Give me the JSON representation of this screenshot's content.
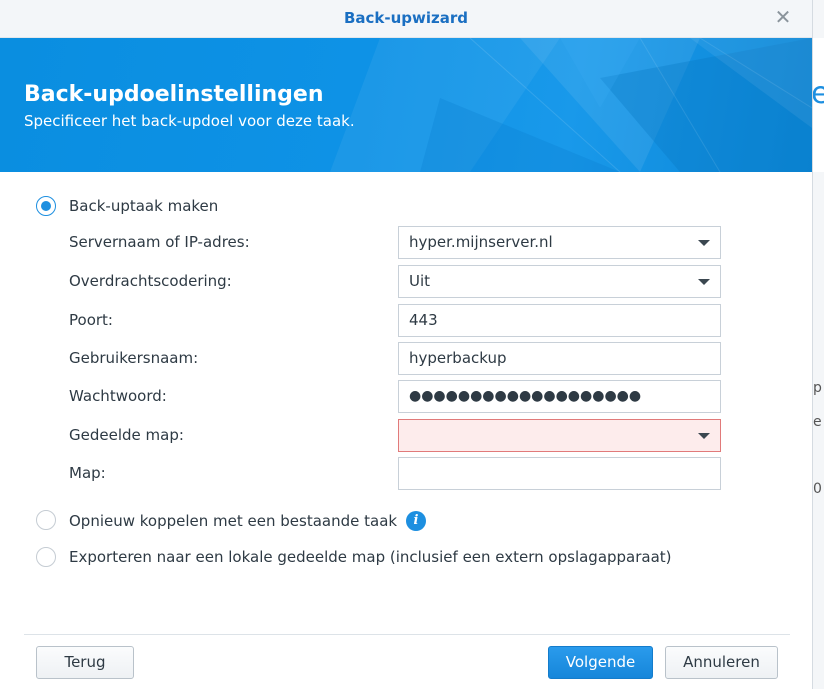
{
  "window": {
    "title": "Back-upwizard"
  },
  "banner": {
    "heading": "Back-updoelinstellingen",
    "subheading": "Specificeer het back-updoel voor deze taak."
  },
  "options": {
    "create": "Back-uptaak maken",
    "relink": "Opnieuw koppelen met een bestaande taak",
    "export": "Exporteren naar een lokale gedeelde map (inclusief een extern opslagapparaat)"
  },
  "form": {
    "server_label": "Servernaam of IP-adres:",
    "server_value": "hyper.mijnserver.nl",
    "encryption_label": "Overdrachtscodering:",
    "encryption_value": "Uit",
    "port_label": "Poort:",
    "port_value": "443",
    "username_label": "Gebruikersnaam:",
    "username_value": "hyperbackup",
    "password_label": "Wachtwoord:",
    "password_value": "●●●●●●●●●●●●●●●●●●●",
    "shared_folder_label": "Gedeelde map:",
    "shared_folder_value": "",
    "folder_label": "Map:",
    "folder_value": ""
  },
  "buttons": {
    "back": "Terug",
    "next": "Volgende",
    "cancel": "Annuleren"
  },
  "background_app": {
    "glyph_e": "e",
    "glyph_p": "p",
    "glyph_e2": "e",
    "glyph_0": "0"
  },
  "colors": {
    "accent": "#1d8fe0",
    "banner": "#0e92e6",
    "error_bg": "#fdecec",
    "error_border": "#e17a7a"
  },
  "icons": {
    "close": "close-icon",
    "info": "info-icon",
    "dropdown": "chevron-down-icon"
  }
}
